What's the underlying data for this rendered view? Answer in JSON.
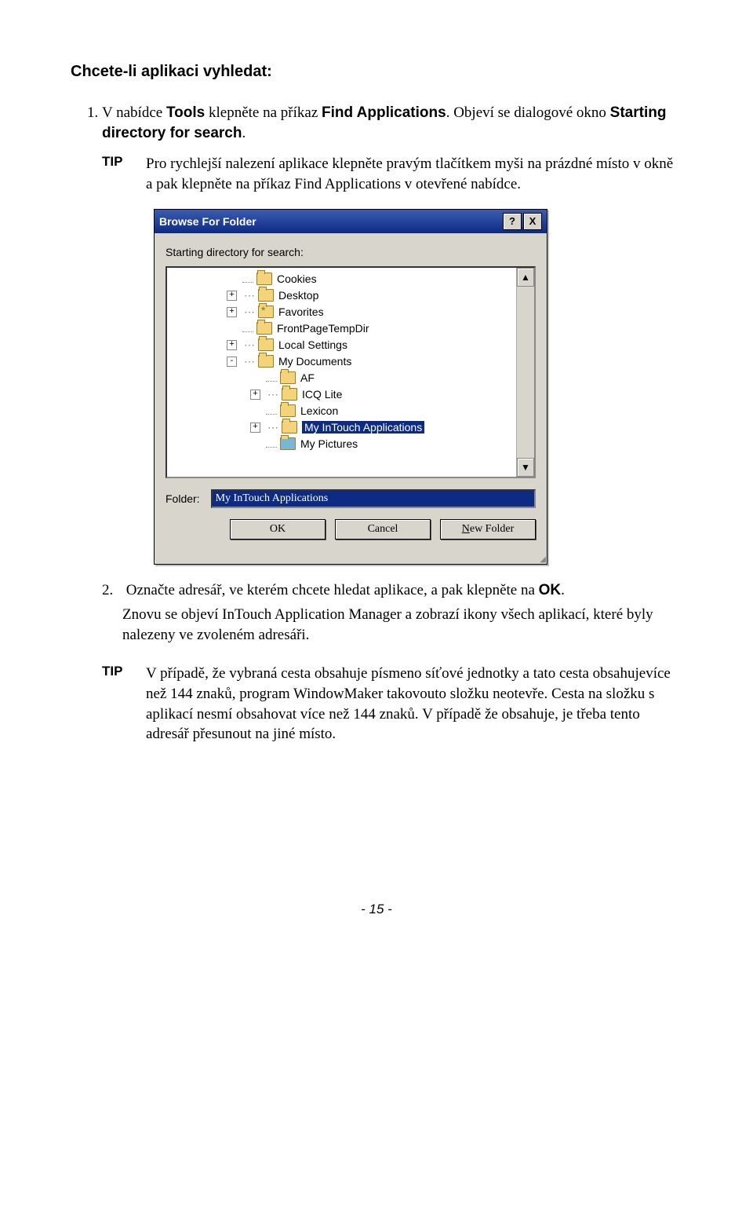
{
  "heading": "Chcete-li aplikaci vyhledat:",
  "step1": {
    "pre": "V nabídce ",
    "bold1": "Tools",
    "mid": " klepněte na příkaz ",
    "bold2": "Find Applications",
    "post1": ". Objeví se dialogové okno ",
    "bold3": "Starting directory for search",
    "post2": "."
  },
  "tip1": {
    "label": "TIP",
    "text": "Pro rychlejší nalezení aplikace klepněte pravým tlačítkem myši na prázdné místo v okně a pak klepněte na příkaz Find Applications v otevřené nabídce."
  },
  "dialog": {
    "title": "Browse For Folder",
    "prompt": "Starting directory for search:",
    "tree": [
      {
        "indent": 90,
        "exp": "",
        "name": "Cookies"
      },
      {
        "indent": 70,
        "exp": "+",
        "name": "Desktop"
      },
      {
        "indent": 70,
        "exp": "+",
        "star": true,
        "name": "Favorites"
      },
      {
        "indent": 90,
        "exp": "",
        "name": "FrontPageTempDir"
      },
      {
        "indent": 70,
        "exp": "+",
        "name": "Local Settings"
      },
      {
        "indent": 70,
        "exp": "-",
        "name": "My Documents"
      },
      {
        "indent": 120,
        "exp": "",
        "name": "AF"
      },
      {
        "indent": 100,
        "exp": "+",
        "name": "ICQ Lite"
      },
      {
        "indent": 120,
        "exp": "",
        "name": "Lexicon"
      },
      {
        "indent": 100,
        "exp": "+",
        "name": "My InTouch Applications",
        "selected": true
      },
      {
        "indent": 120,
        "exp": "",
        "pic": true,
        "name": "My Pictures"
      }
    ],
    "folder_label": "Folder:",
    "folder_value": "My InTouch Applications",
    "ok": "OK",
    "cancel": "Cancel",
    "newfolder_pre": "N",
    "newfolder_post": "ew Folder",
    "help": "?",
    "close": "X"
  },
  "step2": {
    "number": "2.",
    "pre": "Označte adresář, ve kterém chcete hledat aplikace, a pak klepněte na ",
    "bold": "OK",
    "post": ".",
    "para": "Znovu se objeví InTouch Application Manager a zobrazí ikony všech aplikací, které byly nalezeny ve zvoleném adresáři."
  },
  "tip2": {
    "label": "TIP",
    "text": "V případě, že vybraná cesta obsahuje písmeno síťové jednotky a tato cesta obsahujevíce než 144 znaků, program WindowMaker takovouto složku neotevře. Cesta na složku s aplikací nesmí obsahovat více než 144 znaků. V případě že obsahuje, je třeba tento adresář přesunout na jiné místo."
  },
  "pagenum": "- 15 -"
}
